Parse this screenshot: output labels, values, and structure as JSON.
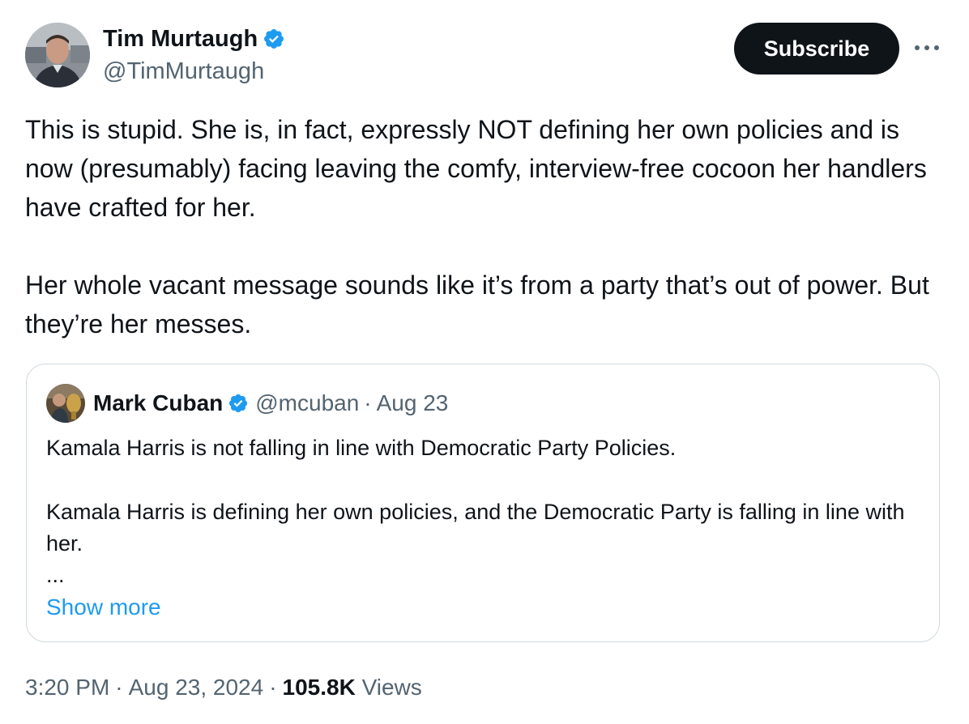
{
  "author": {
    "name": "Tim Murtaugh",
    "handle": "@TimMurtaugh",
    "verified": true
  },
  "header": {
    "subscribe_label": "Subscribe",
    "more_icon": "more-horizontal-icon"
  },
  "tweet": {
    "paragraphs": [
      "This is stupid. She is, in fact, expressly NOT defining her own policies and is now (presumably) facing leaving the comfy, interview-free cocoon her handlers have crafted for her.",
      "Her whole vacant message sounds like it’s from a party that’s out of power. But they’re her messes."
    ]
  },
  "quote": {
    "name": "Mark Cuban",
    "handle": "@mcuban",
    "separator": "·",
    "date": "Aug 23",
    "paragraphs": [
      "Kamala Harris is not falling in line with Democratic Party Policies.",
      "Kamala Harris is defining her own policies, and the Democratic Party is falling in line with her."
    ],
    "ellipsis": "...",
    "show_more": "Show more"
  },
  "meta": {
    "time": "3:20 PM",
    "separator": "·",
    "date": "Aug 23, 2024",
    "views_count": "105.8K",
    "views_label": "Views"
  },
  "colors": {
    "text": "#0f1419",
    "secondary": "#536471",
    "link": "#1d9bf0",
    "verified": "#1d9bf0",
    "border": "#cfd9de"
  }
}
